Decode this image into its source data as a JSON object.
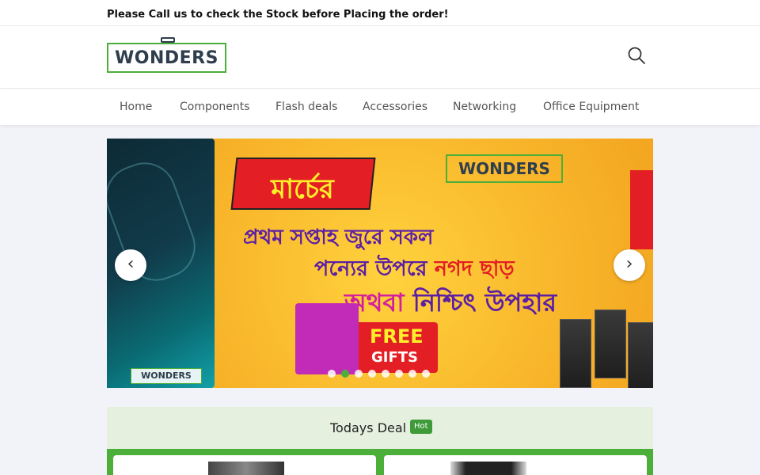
{
  "topbar": {
    "notice": "Please Call us to check the Stock before Placing the order!"
  },
  "header": {
    "logo_text": "WONDERS",
    "search_icon": "search-icon"
  },
  "nav": {
    "items": [
      {
        "label": "Home"
      },
      {
        "label": "Components"
      },
      {
        "label": "Flash deals"
      },
      {
        "label": "Accessories"
      },
      {
        "label": "Networking"
      },
      {
        "label": "Office Equipment"
      }
    ]
  },
  "slider": {
    "dark_slide_logo": "WONDERS",
    "banner_logo": "WONDERS",
    "line_1": "মার্চের",
    "line_2": "প্রথম সপ্তাহ জুরে সকল",
    "line_3a": "পন্যের উপরে",
    "line_3b": "নগদ ছাড়",
    "line_4a": "অথবা",
    "line_4b": "নিশ্চিৎ উপহার",
    "gift_line_1": "FREE",
    "gift_line_2": "GIFTS",
    "prev_icon": "chevron-left-icon",
    "next_icon": "chevron-right-icon",
    "dot_count": 8,
    "active_dot": 2
  },
  "deal": {
    "title": "Todays Deal",
    "badge": "Hot"
  },
  "colors": {
    "accent_green": "#4caf3a",
    "banner_red": "#e31e24",
    "banner_yellow": "#f8b52a",
    "banner_purple": "#5b1ea6"
  }
}
